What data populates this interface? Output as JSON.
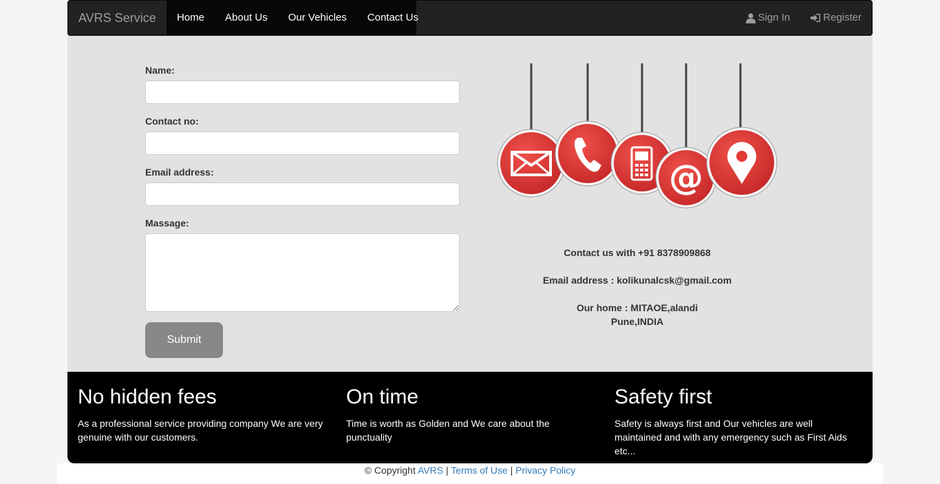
{
  "nav": {
    "brand": "AVRS Service",
    "links": [
      "Home",
      "About Us",
      "Our Vehicles",
      "Contact Us"
    ],
    "sign_in": "Sign In",
    "register": "Register"
  },
  "form": {
    "name_label": "Name:",
    "name_value": "",
    "contact_label": "Contact no:",
    "contact_value": "",
    "email_label": "Email address:",
    "email_value": "",
    "message_label": "Massage:",
    "message_value": "",
    "submit_label": "Submit"
  },
  "contact_icons": [
    "envelope-icon",
    "phone-icon",
    "mobile-icon",
    "at-icon",
    "location-pin-icon"
  ],
  "contact_info": {
    "phone": "Contact us with +91 8378909868",
    "email": "Email address : kolikunalcsk@gmail.com",
    "home_line1": "Our home : MITAOE,alandi",
    "home_line2": "Pune,INDIA"
  },
  "features": [
    {
      "title": "No hidden fees",
      "text": "As a professional service providing company We are very genuine with our customers."
    },
    {
      "title": "On time",
      "text": "Time is worth as Golden and We care about the punctuality"
    },
    {
      "title": "Safety first",
      "text": "Safety is always first and Our vehicles are well maintained and with any emergency such as First Aids etc..."
    }
  ],
  "footer": {
    "copyright": "© Copyright",
    "avrs_link": "AVRS",
    "sep1": "|",
    "terms_link": "Terms of Use",
    "sep2": "|",
    "privacy_link": "Privacy Policy"
  },
  "colors": {
    "navbar_bg": "#222222",
    "active_nav_bg": "#080808",
    "main_bg": "#e2e2e2",
    "tag_red": "#e53935",
    "link_blue": "#337ab7",
    "submit_bg": "#888888"
  }
}
